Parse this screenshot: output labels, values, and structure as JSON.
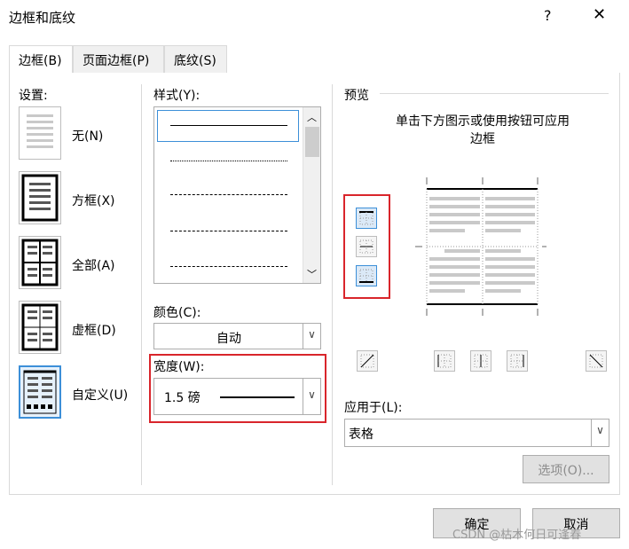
{
  "window": {
    "title": "边框和底纹",
    "help": "?",
    "close": "✕"
  },
  "tabs": [
    {
      "label": "边框(B)"
    },
    {
      "label": "页面边框(P)"
    },
    {
      "label": "底纹(S)"
    }
  ],
  "settings": {
    "heading": "设置:",
    "items": [
      {
        "label": "无(N)"
      },
      {
        "label": "方框(X)"
      },
      {
        "label": "全部(A)"
      },
      {
        "label": "虚框(D)"
      },
      {
        "label": "自定义(U)"
      }
    ]
  },
  "style": {
    "label": "样式(Y):"
  },
  "color": {
    "label": "颜色(C):",
    "value": "自动"
  },
  "width": {
    "label": "宽度(W):",
    "value": "1.5 磅"
  },
  "preview": {
    "heading": "预览",
    "hint": "单击下方图示或使用按钮可应用边框"
  },
  "apply": {
    "label": "应用于(L):",
    "value": "表格"
  },
  "options_button": "选项(O)...",
  "ok_button": "确定",
  "cancel_button": "取消",
  "watermark": "CSDN @枯木何日可逢春"
}
